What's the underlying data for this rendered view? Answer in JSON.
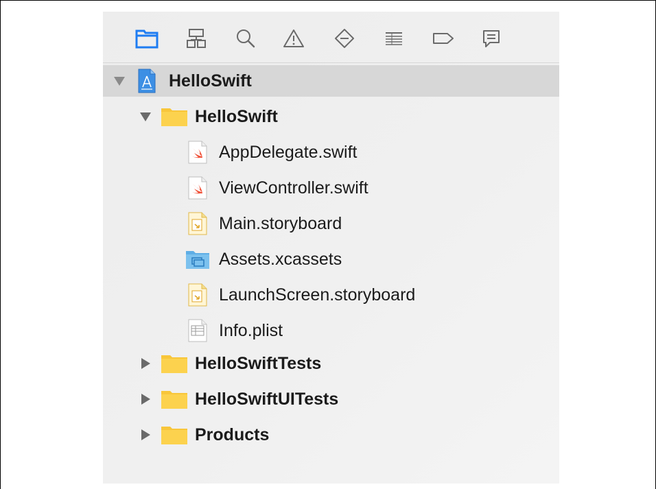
{
  "toolbar": {
    "icons": [
      "project-navigator-icon",
      "symbol-navigator-icon",
      "find-navigator-icon",
      "issue-navigator-icon",
      "test-navigator-icon",
      "debug-navigator-icon",
      "breakpoint-navigator-icon",
      "report-navigator-icon"
    ],
    "active_color": "#1e7cf2",
    "inactive_color": "#6a6a6a"
  },
  "tree": {
    "project": {
      "label": "HelloSwift",
      "expanded": true
    },
    "group": {
      "label": "HelloSwift",
      "expanded": true
    },
    "files": [
      {
        "label": "AppDelegate.swift",
        "icon": "swift-file-icon",
        "badge": "SWIFT"
      },
      {
        "label": "ViewController.swift",
        "icon": "swift-file-icon",
        "badge": "SWIFT"
      },
      {
        "label": "Main.storyboard",
        "icon": "storyboard-file-icon"
      },
      {
        "label": "Assets.xcassets",
        "icon": "asset-catalog-icon"
      },
      {
        "label": "LaunchScreen.storyboard",
        "icon": "storyboard-file-icon"
      },
      {
        "label": "Info.plist",
        "icon": "plist-file-icon",
        "badge": "PLIST"
      }
    ],
    "collapsed_groups": [
      {
        "label": "HelloSwiftTests",
        "expanded": false
      },
      {
        "label": "HelloSwiftUITests",
        "expanded": false
      },
      {
        "label": "Products",
        "expanded": false
      }
    ]
  },
  "colors": {
    "folder": "#f8c63a",
    "asset_folder": "#6fb8ea",
    "swift": "#f05138",
    "selection": "#d7d7d7"
  }
}
